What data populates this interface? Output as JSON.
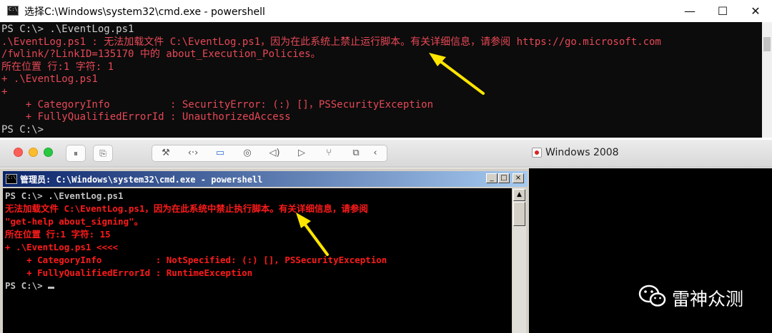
{
  "top_window": {
    "title": "选择C:\\Windows\\system32\\cmd.exe - powershell",
    "icon_text": "C:\\",
    "controls": {
      "minimize": "—",
      "maximize": "☐",
      "close": "✕"
    },
    "console_lines": [
      {
        "color": "white",
        "text": "PS C:\\> .\\EventLog.ps1"
      },
      {
        "color": "red",
        "text": ".\\EventLog.ps1 : 无法加载文件 C:\\EventLog.ps1，因为在此系统上禁止运行脚本。有关详细信息，请参阅 https://go.microsoft.com"
      },
      {
        "color": "red",
        "text": "/fwlink/?LinkID=135170 中的 about_Execution_Policies。"
      },
      {
        "color": "red",
        "text": "所在位置 行:1 字符: 1"
      },
      {
        "color": "red",
        "text": "+ .\\EventLog.ps1"
      },
      {
        "color": "red",
        "text": "+"
      },
      {
        "color": "red",
        "text": "    + CategoryInfo          : SecurityError: (:) []，PSSecurityException"
      },
      {
        "color": "red",
        "text": "    + FullyQualifiedErrorId : UnauthorizedAccess"
      },
      {
        "color": "white",
        "text": "PS C:\\>"
      }
    ]
  },
  "vm_window": {
    "title": "Windows 2008",
    "toolbar_icons": [
      "pause-icon",
      "snapshot-icon",
      "wrench-icon",
      "network-arrows-icon",
      "hard-disk-icon",
      "camera-icon",
      "speaker-icon",
      "video-camera-icon",
      "usb-icon",
      "shared-folder-icon",
      "chevron-left-icon"
    ],
    "toolbar_glyphs": {
      "pause": "⏸",
      "snapshot": "⎘",
      "wrench": "⚒",
      "network": "‹·›",
      "disk": "▭",
      "camera": "◎",
      "speaker": "◁)",
      "video": "▷",
      "usb": "⑂",
      "folder": "⧉",
      "chevron": "‹"
    }
  },
  "inner_window": {
    "title": "管理员: C:\\Windows\\system32\\cmd.exe - powershell",
    "icon_text": "C:\\",
    "controls": {
      "minimize": "_",
      "maximize": "□",
      "close": "×"
    },
    "scroll_up": "▲",
    "scroll_down": "▼",
    "console_lines": [
      {
        "color": "white",
        "text": "PS C:\\> .\\EventLog.ps1"
      },
      {
        "color": "red",
        "text": "无法加载文件 C:\\EventLog.ps1，因为在此系统中禁止执行脚本。有关详细信息，请参阅"
      },
      {
        "color": "red",
        "text": "\"get-help about_signing\"。"
      },
      {
        "color": "red",
        "text": "所在位置 行:1 字符: 15"
      },
      {
        "color": "red",
        "text": "+ .\\EventLog.ps1 <<<<"
      },
      {
        "color": "red",
        "text": "    + CategoryInfo          : NotSpecified: (:) [], PSSecurityException"
      },
      {
        "color": "red",
        "text": "    + FullyQualifiedErrorId : RuntimeException"
      },
      {
        "color": "white",
        "text": ""
      },
      {
        "color": "white",
        "text": "PS C:\\> "
      }
    ]
  },
  "watermark": {
    "text": "雷神众测"
  },
  "colors": {
    "console_red": "#e74856",
    "console_white": "#cccccc",
    "inner_red": "#ff1a1a",
    "arrow": "#ffe600"
  }
}
